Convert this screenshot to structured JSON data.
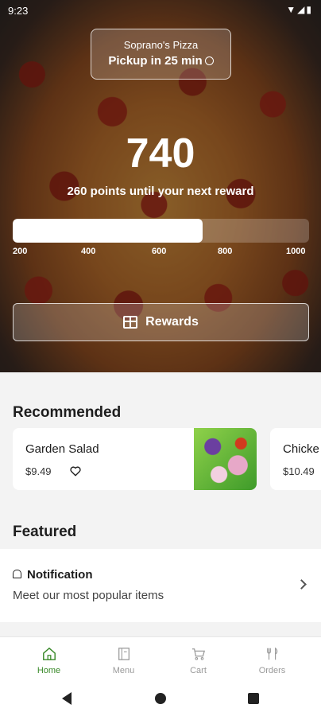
{
  "status_bar": {
    "time": "9:23",
    "icons": [
      "wifi-icon",
      "signal-icon",
      "battery-icon"
    ]
  },
  "store": {
    "name": "Soprano's Pizza",
    "pickup": "Pickup in 25 min"
  },
  "loyalty": {
    "points": "740",
    "subtitle": "260 points until your next reward",
    "progress_fraction": 0.64,
    "ticks": [
      "200",
      "400",
      "600",
      "800",
      "1000"
    ],
    "rewards_label": "Rewards"
  },
  "recommended": {
    "title": "Recommended",
    "items": [
      {
        "name": "Garden Salad",
        "price": "$9.49"
      },
      {
        "name": "Chicke",
        "price": "$10.49"
      }
    ]
  },
  "featured": {
    "title": "Featured",
    "notification_label": "Notification",
    "notification_text": "Meet our most popular items"
  },
  "bottom_nav": [
    {
      "label": "Home",
      "active": true
    },
    {
      "label": "Menu",
      "active": false
    },
    {
      "label": "Cart",
      "active": false
    },
    {
      "label": "Orders",
      "active": false
    }
  ],
  "colors": {
    "accent": "#3a8a2a",
    "inactive": "#9a9a9a"
  }
}
